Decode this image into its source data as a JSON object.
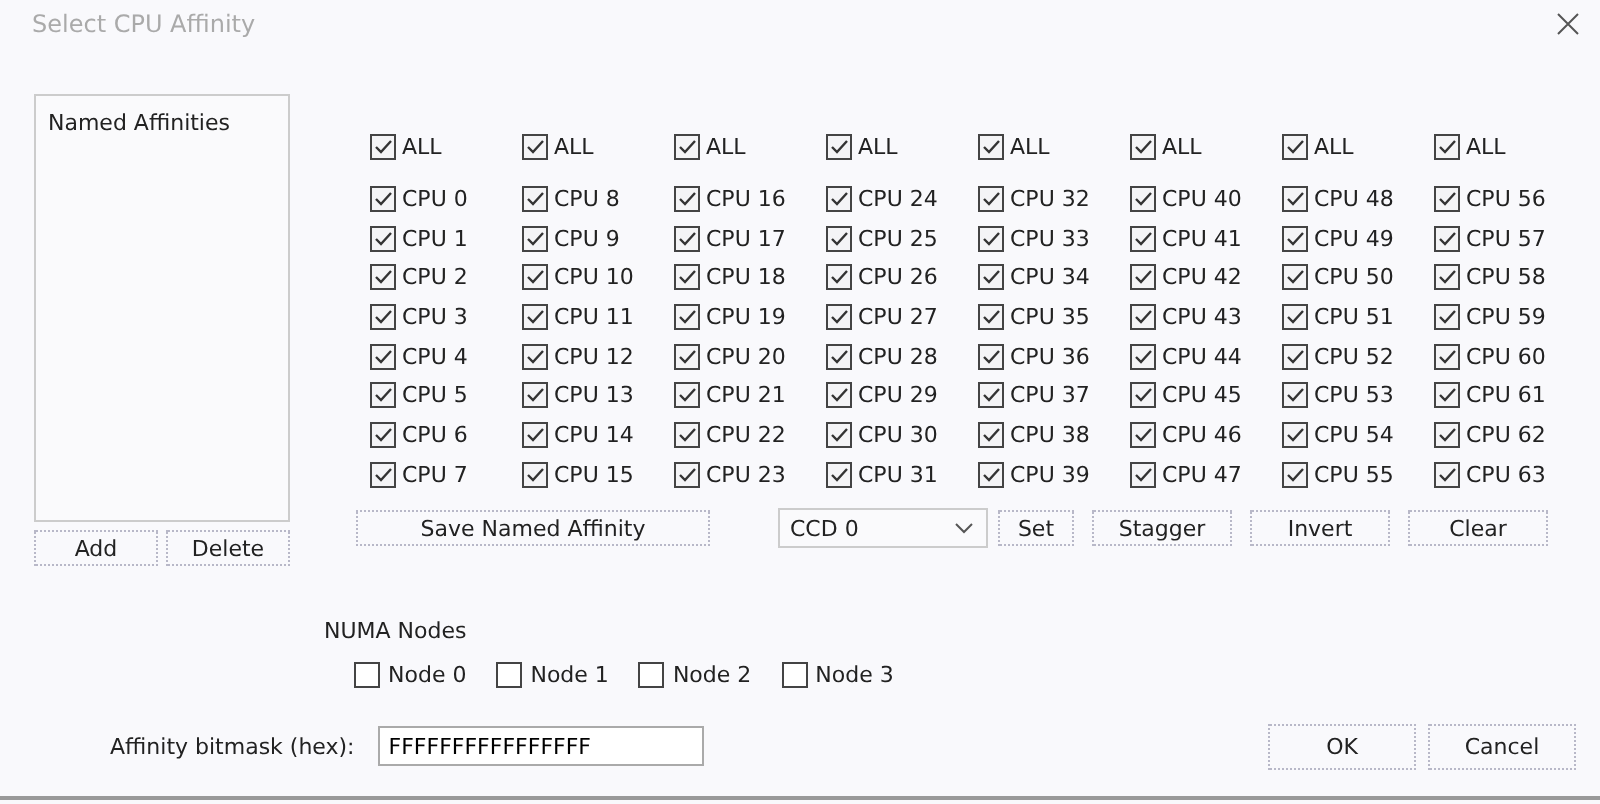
{
  "window": {
    "title": "Select CPU Affinity"
  },
  "named_affinities": {
    "label": "Named Affinities",
    "buttons": [
      "Add",
      "Delete"
    ]
  },
  "cpu_columns": [
    {
      "all": {
        "label": "ALL",
        "checked": true
      },
      "cpus": [
        {
          "label": "CPU 0",
          "checked": true
        },
        {
          "label": "CPU 1",
          "checked": true
        },
        {
          "label": "CPU 2",
          "checked": true
        },
        {
          "label": "CPU 3",
          "checked": true
        },
        {
          "label": "CPU 4",
          "checked": true
        },
        {
          "label": "CPU 5",
          "checked": true
        },
        {
          "label": "CPU 6",
          "checked": true
        },
        {
          "label": "CPU 7",
          "checked": true
        }
      ]
    },
    {
      "all": {
        "label": "ALL",
        "checked": true
      },
      "cpus": [
        {
          "label": "CPU 8",
          "checked": true
        },
        {
          "label": "CPU 9",
          "checked": true
        },
        {
          "label": "CPU 10",
          "checked": true
        },
        {
          "label": "CPU 11",
          "checked": true
        },
        {
          "label": "CPU 12",
          "checked": true
        },
        {
          "label": "CPU 13",
          "checked": true
        },
        {
          "label": "CPU 14",
          "checked": true
        },
        {
          "label": "CPU 15",
          "checked": true
        }
      ]
    },
    {
      "all": {
        "label": "ALL",
        "checked": true
      },
      "cpus": [
        {
          "label": "CPU 16",
          "checked": true
        },
        {
          "label": "CPU 17",
          "checked": true
        },
        {
          "label": "CPU 18",
          "checked": true
        },
        {
          "label": "CPU 19",
          "checked": true
        },
        {
          "label": "CPU 20",
          "checked": true
        },
        {
          "label": "CPU 21",
          "checked": true
        },
        {
          "label": "CPU 22",
          "checked": true
        },
        {
          "label": "CPU 23",
          "checked": true
        }
      ]
    },
    {
      "all": {
        "label": "ALL",
        "checked": true
      },
      "cpus": [
        {
          "label": "CPU 24",
          "checked": true
        },
        {
          "label": "CPU 25",
          "checked": true
        },
        {
          "label": "CPU 26",
          "checked": true
        },
        {
          "label": "CPU 27",
          "checked": true
        },
        {
          "label": "CPU 28",
          "checked": true
        },
        {
          "label": "CPU 29",
          "checked": true
        },
        {
          "label": "CPU 30",
          "checked": true
        },
        {
          "label": "CPU 31",
          "checked": true
        }
      ]
    },
    {
      "all": {
        "label": "ALL",
        "checked": true
      },
      "cpus": [
        {
          "label": "CPU 32",
          "checked": true
        },
        {
          "label": "CPU 33",
          "checked": true
        },
        {
          "label": "CPU 34",
          "checked": true
        },
        {
          "label": "CPU 35",
          "checked": true
        },
        {
          "label": "CPU 36",
          "checked": true
        },
        {
          "label": "CPU 37",
          "checked": true
        },
        {
          "label": "CPU 38",
          "checked": true
        },
        {
          "label": "CPU 39",
          "checked": true
        }
      ]
    },
    {
      "all": {
        "label": "ALL",
        "checked": true
      },
      "cpus": [
        {
          "label": "CPU 40",
          "checked": true
        },
        {
          "label": "CPU 41",
          "checked": true
        },
        {
          "label": "CPU 42",
          "checked": true
        },
        {
          "label": "CPU 43",
          "checked": true
        },
        {
          "label": "CPU 44",
          "checked": true
        },
        {
          "label": "CPU 45",
          "checked": true
        },
        {
          "label": "CPU 46",
          "checked": true
        },
        {
          "label": "CPU 47",
          "checked": true
        }
      ]
    },
    {
      "all": {
        "label": "ALL",
        "checked": true
      },
      "cpus": [
        {
          "label": "CPU 48",
          "checked": true
        },
        {
          "label": "CPU 49",
          "checked": true
        },
        {
          "label": "CPU 50",
          "checked": true
        },
        {
          "label": "CPU 51",
          "checked": true
        },
        {
          "label": "CPU 52",
          "checked": true
        },
        {
          "label": "CPU 53",
          "checked": true
        },
        {
          "label": "CPU 54",
          "checked": true
        },
        {
          "label": "CPU 55",
          "checked": true
        }
      ]
    },
    {
      "all": {
        "label": "ALL",
        "checked": true
      },
      "cpus": [
        {
          "label": "CPU 56",
          "checked": true
        },
        {
          "label": "CPU 57",
          "checked": true
        },
        {
          "label": "CPU 58",
          "checked": true
        },
        {
          "label": "CPU 59",
          "checked": true
        },
        {
          "label": "CPU 60",
          "checked": true
        },
        {
          "label": "CPU 61",
          "checked": true
        },
        {
          "label": "CPU 62",
          "checked": true
        },
        {
          "label": "CPU 63",
          "checked": true
        }
      ]
    }
  ],
  "save_button": "Save Named Affinity",
  "ccd_dropdown": {
    "value": "CCD 0"
  },
  "set_button": "Set",
  "actions": [
    "Stagger",
    "Invert",
    "Clear"
  ],
  "numa": {
    "label": "NUMA Nodes",
    "nodes": [
      {
        "label": "Node 0",
        "checked": false
      },
      {
        "label": "Node 1",
        "checked": false
      },
      {
        "label": "Node 2",
        "checked": false
      },
      {
        "label": "Node 3",
        "checked": false
      }
    ]
  },
  "bitmask": {
    "label": "Affinity bitmask (hex):",
    "value": "FFFFFFFFFFFFFFFF"
  },
  "dialog_buttons": [
    "OK",
    "Cancel"
  ]
}
